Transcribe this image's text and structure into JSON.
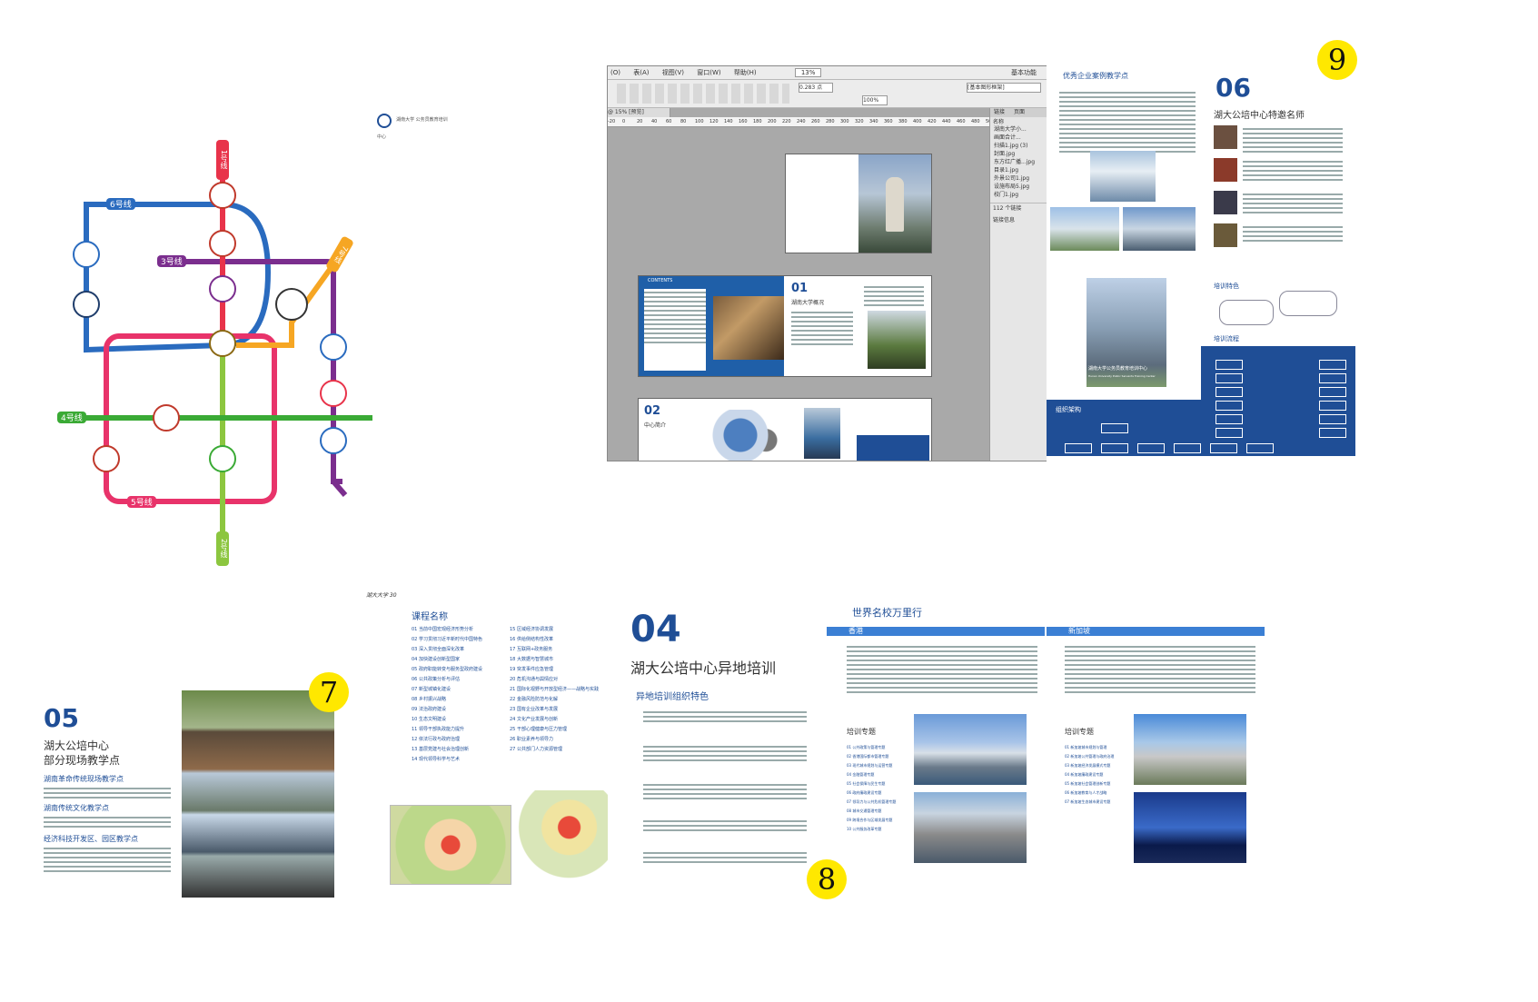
{
  "metro": {
    "logo_text": "湖南大学 公务员教育培训中心",
    "lines": [
      {
        "id": "line1",
        "label": "1号线",
        "color": "#e8334a"
      },
      {
        "id": "line2",
        "label": "2号线",
        "color": "#8cc63f"
      },
      {
        "id": "line3",
        "label": "3号线",
        "color": "#7b2e8e"
      },
      {
        "id": "line4",
        "label": "4号线",
        "color": "#3aaa35"
      },
      {
        "id": "line5",
        "label": "5号线",
        "color": "#e8336a"
      },
      {
        "id": "line6",
        "label": "6号线",
        "color": "#2a6bbf"
      },
      {
        "id": "line7",
        "label": "7号线",
        "color": "#f6a623"
      }
    ]
  },
  "software": {
    "menu": [
      "(O)",
      "表(A)",
      "视图(V)",
      "窗口(W)",
      "帮助(H)",
      "基本功能"
    ],
    "zoom": "13%",
    "tab": "@ 15% [预览]",
    "stroke": "0.283 点",
    "opacity": "100%",
    "style_name": "[基本图形框架]",
    "panels": [
      "链接",
      "页面"
    ],
    "links_header": "名称",
    "links": [
      "湖南大学小...",
      "画面合计...",
      "扫描1.jpg (3)",
      "封面.jpg",
      "东方红广播...jpg",
      "目录1.jpg",
      "外景公司1.jpg",
      "设施布局5.jpg",
      "校门1.jpg"
    ],
    "links_footer": "112 个链接",
    "extra_panel": "链接信息",
    "ruler_ticks": [
      "-20",
      "0",
      "20",
      "40",
      "60",
      "80",
      "100",
      "120",
      "140",
      "160",
      "180",
      "200",
      "220",
      "240",
      "260",
      "280",
      "300",
      "320",
      "340",
      "360",
      "380",
      "400",
      "420",
      "440",
      "460",
      "480",
      "500"
    ],
    "spreads": {
      "contents": "CONTENTS",
      "s01_num": "01",
      "s01_title": "湖南大学概况",
      "s02_num": "02",
      "s02_title": "中心简介"
    }
  },
  "page9": {
    "badge": "9",
    "left_heading": "优秀企业案例教学点",
    "num": "06",
    "title": "湖大公培中心特邀名师",
    "sec1": "培训特色",
    "sec2": "培训流程",
    "sec3": "组织架构",
    "building_sign": "湖南大学公务员教育培训中心",
    "building_sign_en": "Hunan University Public Servants Training Center"
  },
  "page7": {
    "badge": "7",
    "num": "05",
    "title_l1": "湖大公培中心",
    "title_l2": "部分现场教学点",
    "s1": "湖南革命传统现场教学点",
    "s2": "湖南传统文化教学点",
    "s3": "经济科技开发区、园区教学点",
    "course_header": "课程名称",
    "page_marker": "湖大大学 30",
    "courses_left": [
      "01 当前中国宏观经济形势分析",
      "02 学习贯彻习近平新时代中国特色",
      "03 深入贯彻全面深化改革",
      "04 加快建设创新型国家",
      "05 政府职能转变与服务型政府建设",
      "06 公共政策分析与评估",
      "07 新型城镇化建设",
      "08 乡村振兴战略",
      "09 法治政府建设",
      "10 生态文明建设",
      "11 领导干部执政能力提升",
      "12 依法行政与政府治理",
      "13 基层党建与社会治理创新",
      "14 现代领导科学与艺术"
    ],
    "courses_right": [
      "15 区域经济协调发展",
      "16 供给侧结构性改革",
      "17 互联网+政务服务",
      "18 大数据与智慧城市",
      "19 突发事件应急管理",
      "20 危机沟通与舆情应对",
      "21 国际化视野与开放型经济——战略与实践",
      "22 金融风险防范与化解",
      "23 国有企业改革与发展",
      "24 文化产业发展与创新",
      "25 干部心理健康与压力管理",
      "26 职业素养与领导力",
      "27 公共部门人力资源管理"
    ]
  },
  "page8": {
    "badge": "8",
    "num": "04",
    "title": "湖大公培中心异地培训",
    "sub": "异地培训组织特色",
    "right_heading": "世界名校万里行",
    "col_left": "香港",
    "col_right": "新加坡",
    "topic_left": "培训专题",
    "topic_right": "培训专题",
    "topics_left": [
      "01 公共政策与管理专题",
      "02 香港国际都市管理专题",
      "03 现代城市规划与运营专题",
      "04 金融管理专题",
      "05 社会保障与民生专题",
      "06 政府廉政建设专题",
      "07 领导力与公共危机管理专题",
      "08 城市交通管理专题",
      "09 跨境合作与区域发展专题",
      "10 公共服务改革专题"
    ],
    "topics_right": [
      "01 新加坡城市规划与管理",
      "02 新加坡公共管理与政府治理",
      "03 新加坡经济发展模式专题",
      "04 新加坡廉政建设专题",
      "05 新加坡社会管理创新专题",
      "06 新加坡教育与人才战略",
      "07 新加坡生态城市建设专题"
    ]
  },
  "colors": {
    "brand_blue": "#1f4e96",
    "badge_yellow": "#ffe800"
  }
}
